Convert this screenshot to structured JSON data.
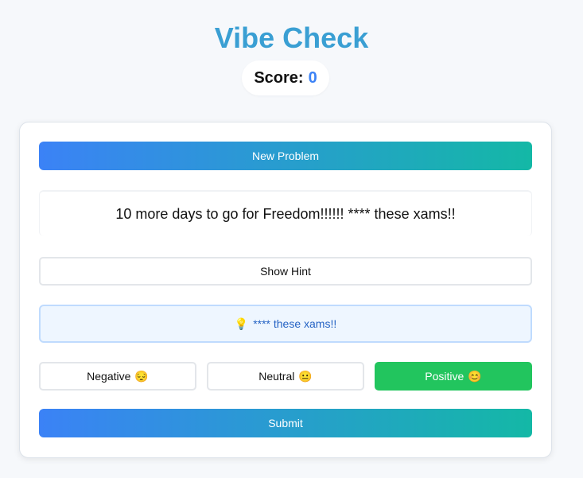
{
  "app": {
    "title": "Vibe Check"
  },
  "score": {
    "label": "Score:",
    "value": "0"
  },
  "card": {
    "new_problem_label": "New Problem",
    "problem_text": "10 more days to go for Freedom!!!!!! **** these xams!!",
    "show_hint_label": "Show Hint",
    "hint": {
      "icon": "💡",
      "text": "**** these xams!!"
    },
    "choices": [
      {
        "label": "Negative",
        "emoji": "😔",
        "selected": false
      },
      {
        "label": "Neutral",
        "emoji": "😐",
        "selected": false
      },
      {
        "label": "Positive",
        "emoji": "😊",
        "selected": true
      }
    ],
    "submit_label": "Submit"
  },
  "colors": {
    "title": "#3a9fd3",
    "score_value": "#3b82f6",
    "gradient_start": "#3b82f6",
    "gradient_end": "#14b8a6",
    "selected_choice": "#22c55e",
    "hint_background": "#eef6ff",
    "hint_text": "#2563c4"
  }
}
